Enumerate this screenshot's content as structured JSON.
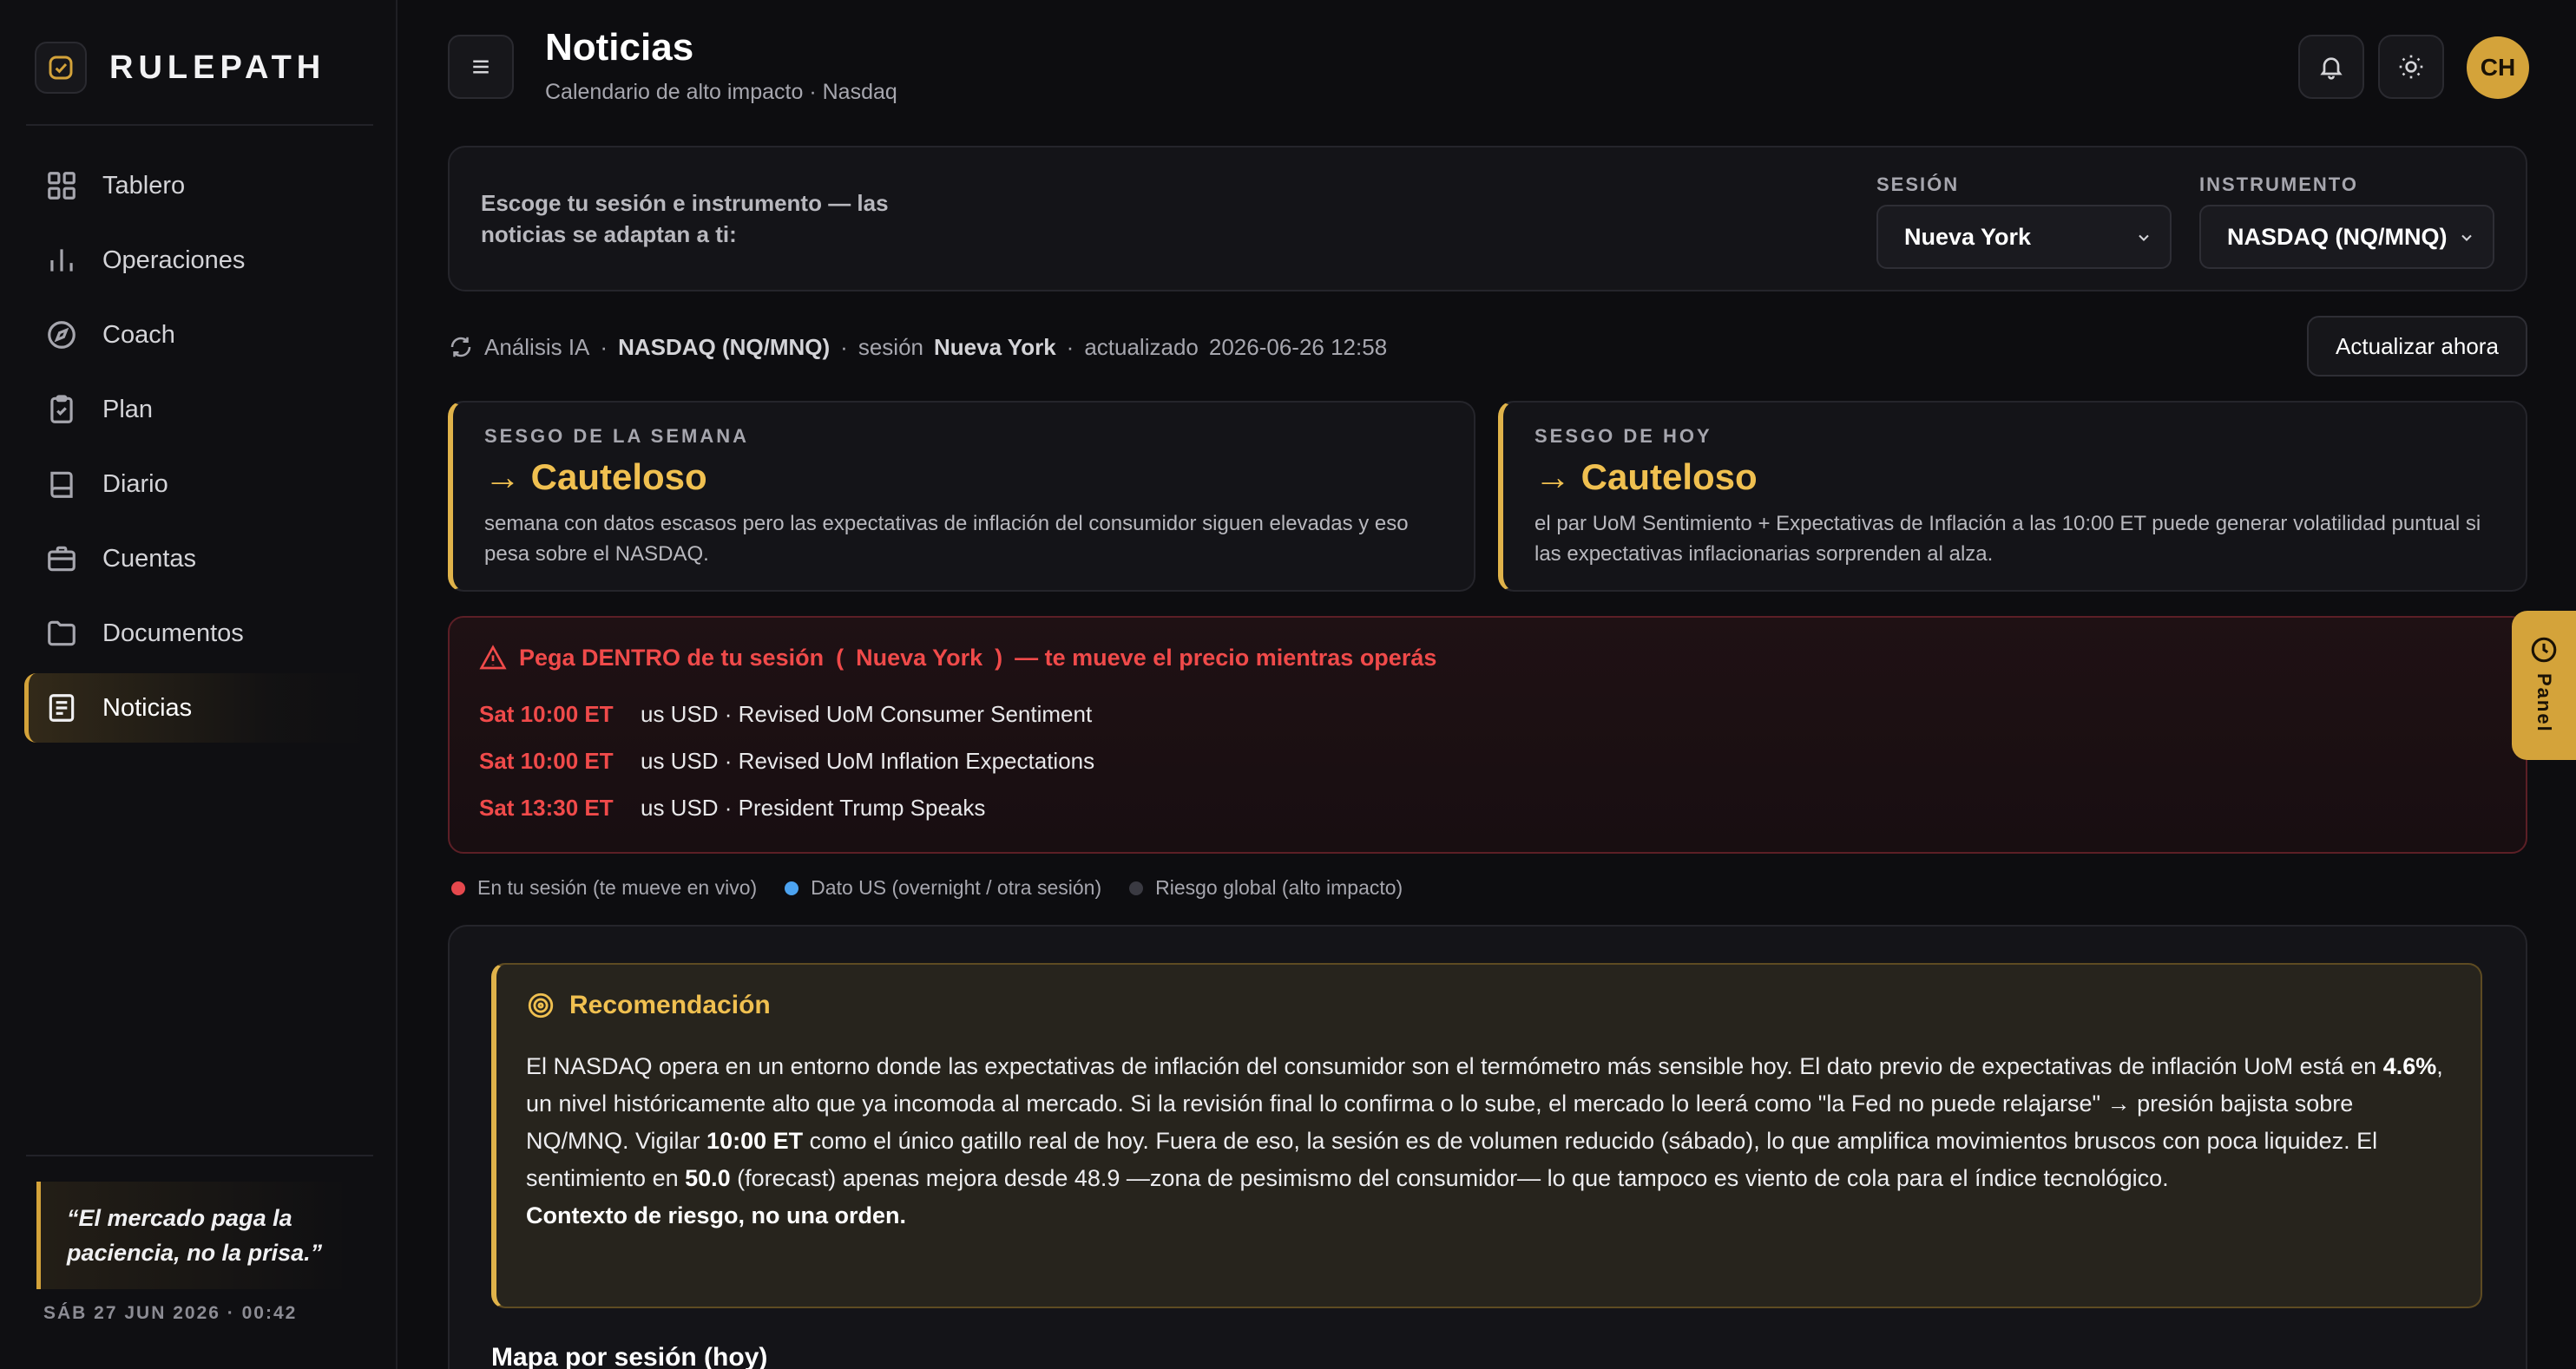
{
  "brand": {
    "name": "RULEPATH"
  },
  "sidebar": {
    "items": [
      {
        "label": "Tablero",
        "icon": "grid-icon"
      },
      {
        "label": "Operaciones",
        "icon": "bar-chart-icon"
      },
      {
        "label": "Coach",
        "icon": "compass-icon"
      },
      {
        "label": "Plan",
        "icon": "clipboard-icon"
      },
      {
        "label": "Diario",
        "icon": "book-icon"
      },
      {
        "label": "Cuentas",
        "icon": "briefcase-icon"
      },
      {
        "label": "Documentos",
        "icon": "folder-icon"
      },
      {
        "label": "Noticias",
        "icon": "newspaper-icon",
        "active": true
      }
    ],
    "quote": "“El mercado paga la paciencia, no la prisa.”",
    "date": "SÁB 27 JUN 2026 · 00:42"
  },
  "header": {
    "title": "Noticias",
    "subtitle": "Calendario de alto impacto · Nasdaq",
    "avatar": "CH"
  },
  "selector": {
    "prompt": "Escoge tu sesión e instrumento — las noticias se adaptan a ti:",
    "session_label": "SESIÓN",
    "session_value": "Nueva York",
    "instrument_label": "INSTRUMENTO",
    "instrument_value": "NASDAQ (NQ/MNQ)"
  },
  "meta": {
    "source": "Análisis IA",
    "instrument": "NASDAQ (NQ/MNQ)",
    "session_word": "sesión",
    "session": "Nueva York",
    "updated_word": "actualizado",
    "updated": "2026-06-26 12:58",
    "refresh_label": "Actualizar ahora"
  },
  "bias": {
    "week": {
      "label": "SESGO DE LA SEMANA",
      "value": "→ Cauteloso",
      "text": "semana con datos escasos pero las expectativas de inflación del consumidor siguen elevadas y eso pesa sobre el NASDAQ."
    },
    "today": {
      "label": "SESGO DE HOY",
      "value": "→ Cauteloso",
      "text": "el par UoM Sentimiento + Expectativas de Inflación a las 10:00 ET puede generar volatilidad puntual si las expectativas inflacionarias sorprenden al alza."
    }
  },
  "alert": {
    "prefix": "Pega DENTRO de tu sesión",
    "open": "(",
    "session": "Nueva York",
    "close": ")",
    "suffix": "— te mueve el precio mientras operás",
    "events": [
      {
        "time": "Sat 10:00 ET",
        "event": "us USD · Revised UoM Consumer Sentiment"
      },
      {
        "time": "Sat 10:00 ET",
        "event": "us USD · Revised UoM Inflation Expectations"
      },
      {
        "time": "Sat 13:30 ET",
        "event": "us USD · President Trump Speaks"
      }
    ]
  },
  "legend": [
    {
      "label": "En tu sesión (te mueve en vivo)",
      "color": "#e5484d"
    },
    {
      "label": "Dato US (overnight / otra sesión)",
      "color": "#4ca3f0"
    },
    {
      "label": "Riesgo global (alto impacto)",
      "color": "#3a3a42"
    }
  ],
  "recommendation": {
    "title": "Recomendación",
    "p1": "El NASDAQ opera en un entorno donde las expectativas de inflación del consumidor son el termómetro más sensible hoy. El dato previo de expectativas de inflación UoM está en ",
    "b1": "4.6%",
    "p2": ", un nivel históricamente alto que ya incomoda al mercado. Si la revisión final lo confirma o lo sube, el mercado lo leerá como \"la Fed no puede relajarse\" → presión bajista sobre NQ/MNQ. Vigilar ",
    "b2": "10:00 ET",
    "p3": " como el único gatillo real de hoy. Fuera de eso, la sesión es de volumen reducido (sábado), lo que amplifica movimientos bruscos con poca liquidez. El sentimiento en ",
    "b3": "50.0",
    "p4": " (forecast) apenas mejora desde 48.9 —zona de pesimismo del consumidor— lo que tampoco es viento de cola para el índice tecnológico.",
    "b4": "Contexto de riesgo, no una orden."
  },
  "map_title": "Mapa por sesión (hoy)",
  "panel_tab": {
    "label": "Panel"
  },
  "colors": {
    "accent": "#d4a33a",
    "danger": "#f04a4a",
    "bias": "#f0c050"
  }
}
